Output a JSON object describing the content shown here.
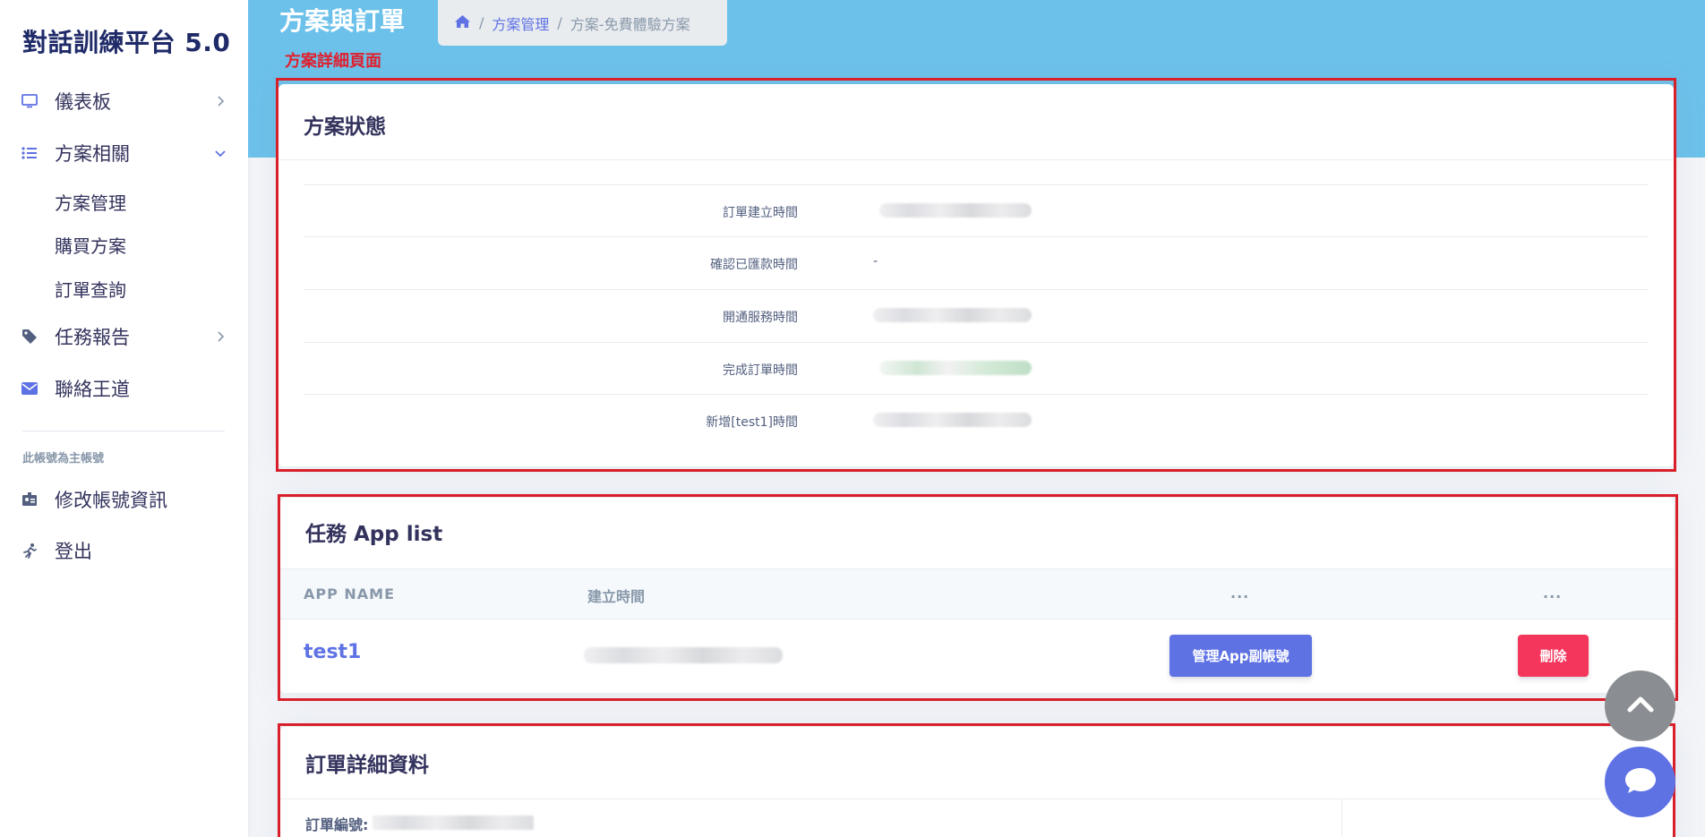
{
  "sidebar": {
    "brand": "對話訓練平台 5.0",
    "items": [
      {
        "label": "儀表板",
        "icon": "monitor-icon"
      },
      {
        "label": "方案相關",
        "icon": "list-icon"
      },
      {
        "label": "任務報告",
        "icon": "tag-icon"
      },
      {
        "label": "聯絡王道",
        "icon": "envelope-icon"
      }
    ],
    "sub_items": [
      "方案管理",
      "購買方案",
      "訂單查詢"
    ],
    "account_heading": "此帳號為主帳號",
    "account_items": [
      {
        "label": "修改帳號資訊",
        "icon": "id-card-icon"
      },
      {
        "label": "登出",
        "icon": "running-icon"
      }
    ]
  },
  "header": {
    "title": "方案與訂單",
    "breadcrumb": [
      "方案管理",
      "方案-免費體驗方案"
    ],
    "annotation": "方案詳細頁面"
  },
  "status_card": {
    "title": "方案狀態",
    "rows": [
      {
        "label": "訂單建立時間",
        "value": ""
      },
      {
        "label": "確認已匯款時間",
        "value": "-"
      },
      {
        "label": "開通服務時間",
        "value": ""
      },
      {
        "label": "完成訂單時間",
        "value": ""
      },
      {
        "label": "新增[test1]時間",
        "value": ""
      }
    ]
  },
  "app_card": {
    "title": "任務 App list",
    "columns": [
      "APP NAME",
      "建立時間",
      "...",
      "..."
    ],
    "rows": [
      {
        "name": "test1",
        "manage_label": "管理App副帳號",
        "delete_label": "刪除"
      }
    ]
  },
  "order_card": {
    "title": "訂單詳細資料",
    "order_no_label": "訂單編號:"
  },
  "colors": {
    "header": "#6cc1ea",
    "primary": "#5e72e4",
    "danger": "#f5365c",
    "annotation": "#d81f2a"
  }
}
